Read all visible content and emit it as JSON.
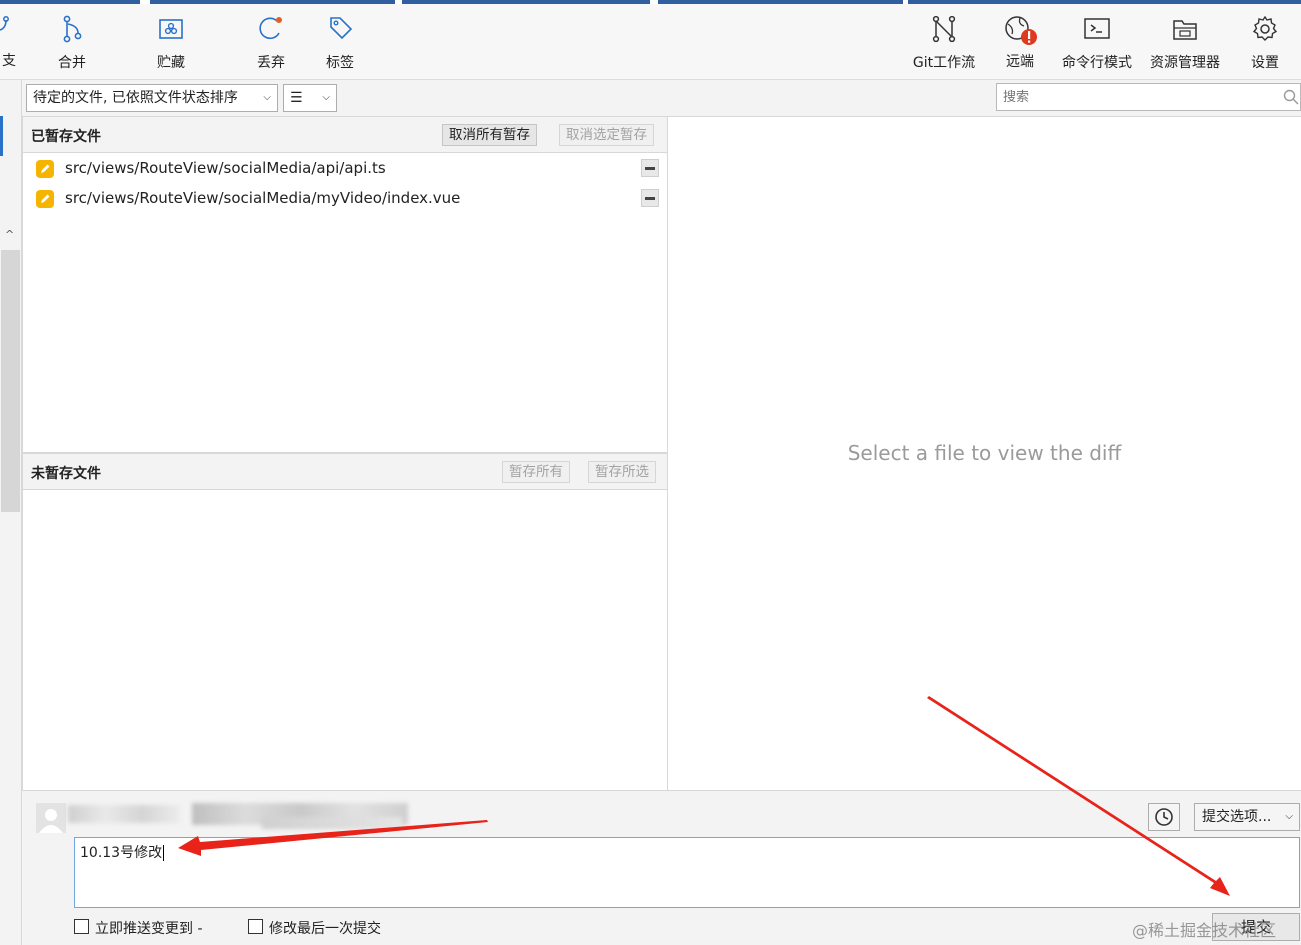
{
  "toolbar": {
    "branch_partial": "支",
    "merge": "合并",
    "stash": "贮藏",
    "discard": "丢弃",
    "tag": "标签",
    "git_flow": "Git工作流",
    "remote": "远端",
    "terminal": "命令行模式",
    "explorer": "资源管理器",
    "settings": "设置"
  },
  "filter": {
    "sort_label": "待定的文件, 已依照文件状态排序",
    "view_label": "☰",
    "search_placeholder": "搜索"
  },
  "staged": {
    "title": "已暂存文件",
    "unstage_all": "取消所有暂存",
    "unstage_selected": "取消选定暂存",
    "files": [
      "src/views/RouteView/socialMedia/api/api.ts",
      "src/views/RouteView/socialMedia/myVideo/index.vue"
    ]
  },
  "unstaged": {
    "title": "未暂存文件",
    "stage_all": "暂存所有",
    "stage_selected": "暂存所选"
  },
  "diff": {
    "empty_message": "Select a file to view the diff"
  },
  "commit": {
    "options_label": "提交选项...",
    "message": "10.13号修改",
    "push_label": "立即推送变更到 -",
    "amend_label": "修改最后一次提交",
    "commit_label": "提交",
    "watermark": "@稀土掘金技术社区"
  },
  "colors": {
    "accent": "#2a72c8",
    "file_modified": "#f5b400",
    "remote_alert": "#e03a1e",
    "annotation_arrow": "#e8231a"
  }
}
